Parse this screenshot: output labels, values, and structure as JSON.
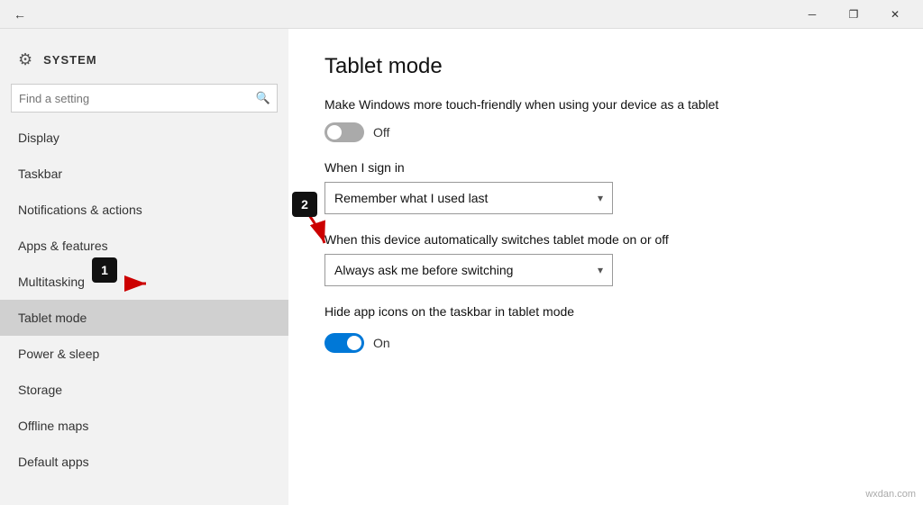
{
  "titlebar": {
    "back_icon": "←",
    "minimize_icon": "─",
    "restore_icon": "❐",
    "close_icon": "✕"
  },
  "search": {
    "placeholder": "Find a setting",
    "icon": "🔍"
  },
  "sidebar": {
    "system_icon": "⚙",
    "system_label": "SYSTEM",
    "items": [
      {
        "id": "display",
        "label": "Display"
      },
      {
        "id": "taskbar",
        "label": "Taskbar"
      },
      {
        "id": "notifications",
        "label": "Notifications & actions"
      },
      {
        "id": "apps",
        "label": "Apps & features"
      },
      {
        "id": "multitasking",
        "label": "Multitasking"
      },
      {
        "id": "tablet-mode",
        "label": "Tablet mode",
        "active": true
      },
      {
        "id": "power-sleep",
        "label": "Power & sleep"
      },
      {
        "id": "storage",
        "label": "Storage"
      },
      {
        "id": "offline-maps",
        "label": "Offline maps"
      },
      {
        "id": "default-apps",
        "label": "Default apps"
      }
    ]
  },
  "content": {
    "title": "Tablet mode",
    "touch_label": "Make Windows more touch-friendly when using your device as a tablet",
    "touch_toggle": "off",
    "touch_toggle_label": "Off",
    "sign_in_label": "When I sign in",
    "sign_in_value": "Remember what I used last",
    "auto_switch_label": "When this device automatically switches tablet mode on or off",
    "auto_switch_value": "Always ask me before switching",
    "hide_icons_label": "Hide app icons on the taskbar in tablet mode",
    "hide_icons_toggle": "on",
    "hide_icons_toggle_label": "On"
  },
  "annotations": {
    "badge1": "1",
    "badge2": "2"
  },
  "watermark": "wxdan.com"
}
